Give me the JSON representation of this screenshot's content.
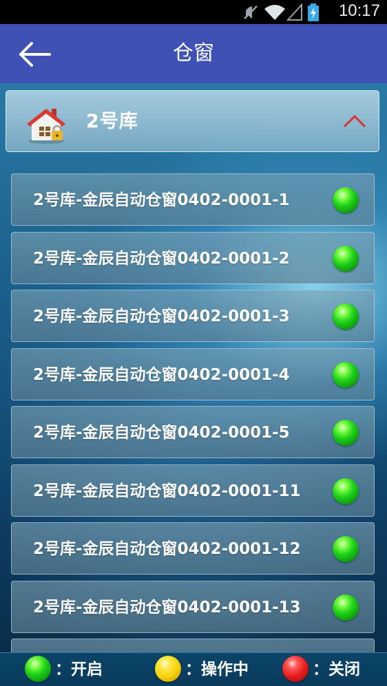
{
  "status_bar": {
    "time": "10:17",
    "icons": [
      "muted-icon",
      "wifi-icon",
      "no-signal-icon",
      "battery-charging-icon"
    ]
  },
  "app_bar": {
    "back_icon": "arrow-left-icon",
    "title": "仓窗"
  },
  "group": {
    "name": "2号库",
    "icon": "house-lock-icon",
    "expanded": true,
    "toggle_icon": "chevron-up-icon",
    "toggle_color": "#d9342b"
  },
  "items": [
    {
      "label": "2号库-金辰自动仓窗0402-0001-1",
      "status": "open"
    },
    {
      "label": "2号库-金辰自动仓窗0402-0001-2",
      "status": "open"
    },
    {
      "label": "2号库-金辰自动仓窗0402-0001-3",
      "status": "open"
    },
    {
      "label": "2号库-金辰自动仓窗0402-0001-4",
      "status": "open"
    },
    {
      "label": "2号库-金辰自动仓窗0402-0001-5",
      "status": "open"
    },
    {
      "label": "2号库-金辰自动仓窗0402-0001-11",
      "status": "open"
    },
    {
      "label": "2号库-金辰自动仓窗0402-0001-12",
      "status": "open"
    },
    {
      "label": "2号库-金辰自动仓窗0402-0001-13",
      "status": "open"
    },
    {
      "label": "",
      "status": "open"
    }
  ],
  "legend": {
    "open": {
      "label": "：开启",
      "color": "#1fd01a"
    },
    "operating": {
      "label": "：操作中",
      "color": "#f7d10a"
    },
    "closed": {
      "label": "：关闭",
      "color": "#e51a1a"
    }
  },
  "colors": {
    "app_bar": "#3f51b5",
    "status_bar": "#000000"
  }
}
